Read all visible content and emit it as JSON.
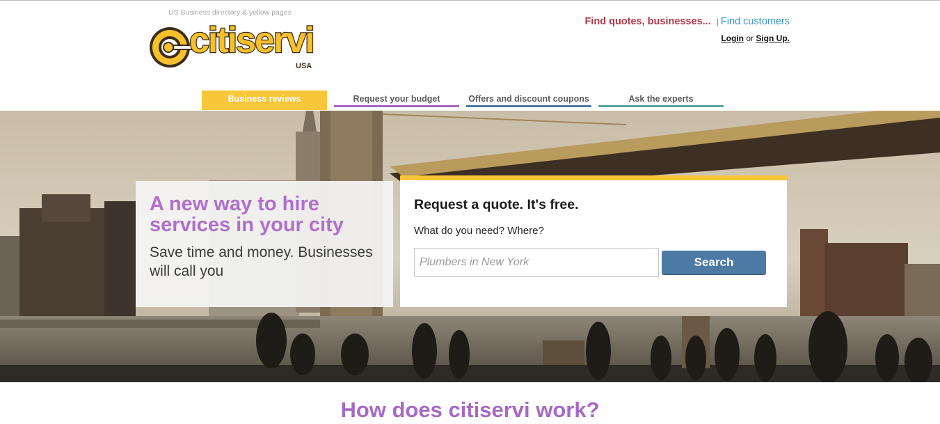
{
  "header": {
    "tagline": "US Business directory & yellow pages",
    "logo_text": "citiservi",
    "logo_sub": "USA",
    "find_quotes_link": "Find quotes, businesses...",
    "separator": "|",
    "find_customers_link": "Find customers",
    "login_link": "Login",
    "or_text": "or",
    "signup_link": "Sign Up."
  },
  "nav": {
    "tabs": [
      {
        "label": "Business reviews",
        "underline": "#f8c63a",
        "active": true
      },
      {
        "label": "Request your budget",
        "underline": "#a566c0",
        "active": false
      },
      {
        "label": "Offers and discount coupons",
        "underline": "#4d7aa5",
        "active": false
      },
      {
        "label": "Ask the experts",
        "underline": "#5aa39a",
        "active": false
      }
    ]
  },
  "hero": {
    "title": "A new way to hire services in your city",
    "subtitle": "Save time and money. Businesses will call you"
  },
  "quote": {
    "title": "Request a quote. It's free.",
    "label": "What do you need? Where?",
    "input_placeholder": "Plumbers in New York",
    "input_value": "",
    "search_button": "Search"
  },
  "how": {
    "title": "How does citiservi work?"
  },
  "colors": {
    "accent_yellow": "#f8c63a",
    "accent_purple": "#a566c0",
    "accent_blue": "#4d7aa5",
    "accent_teal": "#5aa39a",
    "quotes_link": "#b03a48",
    "customers_link": "#3b98c9"
  }
}
